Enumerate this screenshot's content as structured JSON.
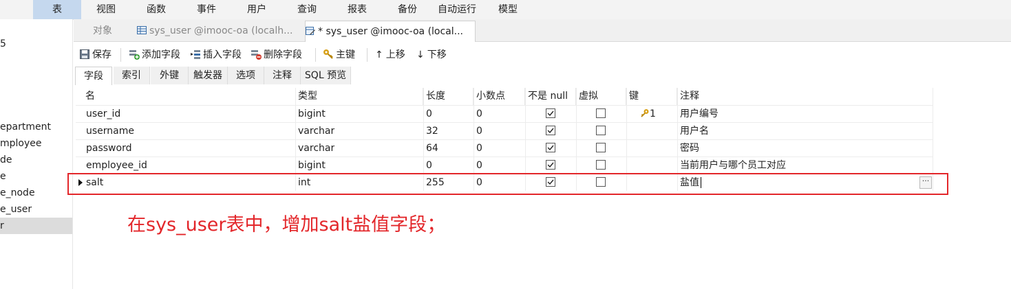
{
  "menubar": {
    "items": [
      "表",
      "视图",
      "函数",
      "事件",
      "用户",
      "查询",
      "报表",
      "备份",
      "自动运行",
      "模型"
    ],
    "active_index": 0
  },
  "sidebar": {
    "items": [
      "5",
      "epartment",
      "mployee",
      "de",
      "e",
      "e_node",
      "e_user",
      "r"
    ],
    "selected_index": 7
  },
  "tabs": {
    "objects_label": "对象",
    "tab1_label": "sys_user @imooc-oa (localh...",
    "tab2_label": "* sys_user @imooc-oa (local..."
  },
  "toolbar": {
    "save": "保存",
    "add_field": "添加字段",
    "insert_field": "插入字段",
    "delete_field": "删除字段",
    "primary_key": "主键",
    "move_up": "上移",
    "move_down": "下移"
  },
  "subtabs": [
    "字段",
    "索引",
    "外键",
    "触发器",
    "选项",
    "注释",
    "SQL 预览"
  ],
  "grid": {
    "columns": [
      "名",
      "类型",
      "长度",
      "小数点",
      "不是 null",
      "虚拟",
      "键",
      "注释"
    ],
    "rows": [
      {
        "name": "user_id",
        "type": "bigint",
        "length": "0",
        "decimals": "0",
        "not_null": true,
        "virtual": false,
        "key": "1",
        "comment": "用户编号"
      },
      {
        "name": "username",
        "type": "varchar",
        "length": "32",
        "decimals": "0",
        "not_null": true,
        "virtual": false,
        "key": "",
        "comment": "用户名"
      },
      {
        "name": "password",
        "type": "varchar",
        "length": "64",
        "decimals": "0",
        "not_null": true,
        "virtual": false,
        "key": "",
        "comment": "密码"
      },
      {
        "name": "employee_id",
        "type": "bigint",
        "length": "0",
        "decimals": "0",
        "not_null": true,
        "virtual": false,
        "key": "",
        "comment": "当前用户与哪个员工对应"
      },
      {
        "name": "salt",
        "type": "int",
        "length": "255",
        "decimals": "0",
        "not_null": true,
        "virtual": false,
        "key": "",
        "comment": "盐值"
      }
    ],
    "ellipsis_label": "···"
  },
  "annotation": "在sys_user表中，增加salt盐值字段；",
  "colors": {
    "highlight": "#e3262a",
    "active_menu": "#c5d8ee",
    "key_icon": "#d9a21b"
  }
}
